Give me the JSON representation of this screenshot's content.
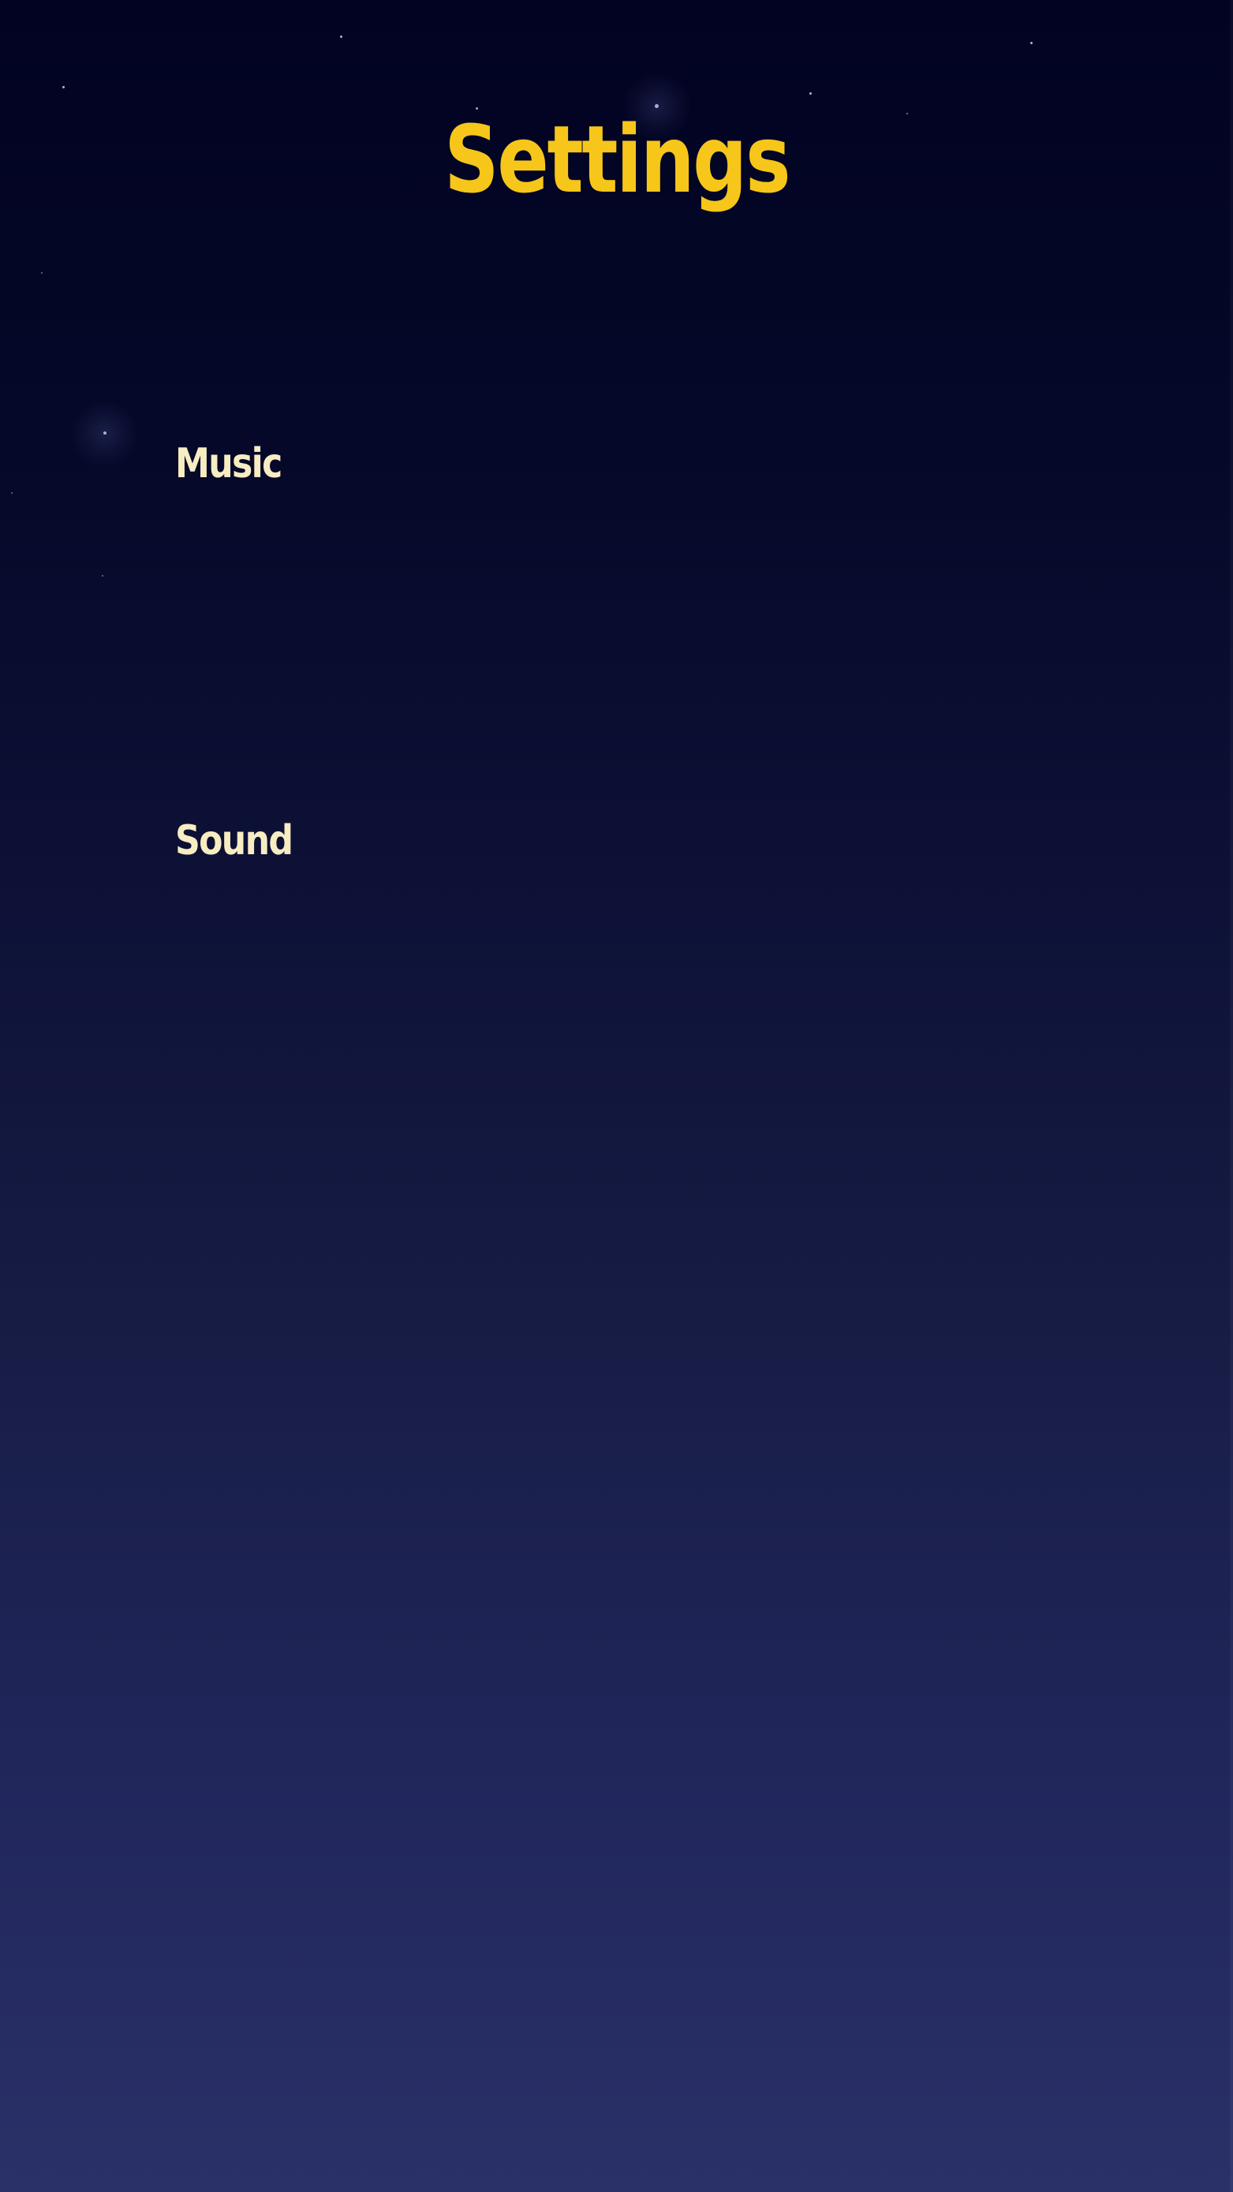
{
  "screen": {
    "title": "Settings"
  },
  "settings": {
    "music_label": "Music",
    "sound_label": "Sound"
  },
  "theme": {
    "title_color": "#f6c61a",
    "label_color": "#f8ecc2",
    "background_top": "#020322",
    "background_bottom": "#2a3168"
  },
  "decorations": {
    "background_icon": "starfield-icon"
  }
}
